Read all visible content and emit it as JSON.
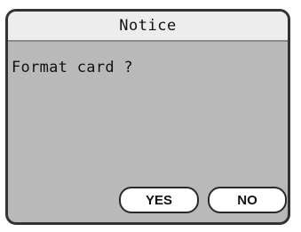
{
  "dialog": {
    "title": "Notice",
    "message": "Format card ?",
    "buttons": {
      "yes_label": "YES",
      "no_label": "NO"
    }
  },
  "colors": {
    "dialog_background": "#b9b9b9",
    "title_bar_background": "#ededed",
    "border": "#333333",
    "button_background": "#ffffff"
  }
}
